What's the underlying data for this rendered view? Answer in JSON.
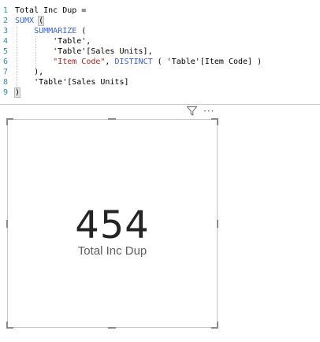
{
  "editor": {
    "lines": [
      {
        "number": "1",
        "tokens": [
          {
            "t": "plain",
            "v": "Total Inc Dup ="
          }
        ]
      },
      {
        "number": "2",
        "tokens": [
          {
            "t": "fn",
            "v": "SUMX"
          },
          {
            "t": "plain",
            "v": " "
          },
          {
            "t": "paren",
            "v": "("
          }
        ]
      },
      {
        "number": "3",
        "tokens": [
          {
            "t": "plain",
            "v": "    "
          },
          {
            "t": "fn",
            "v": "SUMMARIZE"
          },
          {
            "t": "plain",
            "v": " ("
          }
        ]
      },
      {
        "number": "4",
        "tokens": [
          {
            "t": "plain",
            "v": "        'Table',"
          }
        ]
      },
      {
        "number": "5",
        "tokens": [
          {
            "t": "plain",
            "v": "        'Table'[Sales Units],"
          }
        ]
      },
      {
        "number": "6",
        "tokens": [
          {
            "t": "plain",
            "v": "        "
          },
          {
            "t": "str",
            "v": "\"Item Code\""
          },
          {
            "t": "plain",
            "v": ", "
          },
          {
            "t": "fn",
            "v": "DISTINCT"
          },
          {
            "t": "plain",
            "v": " ( 'Table'[Item Code] )"
          }
        ]
      },
      {
        "number": "7",
        "tokens": [
          {
            "t": "plain",
            "v": "    ),"
          }
        ]
      },
      {
        "number": "8",
        "tokens": [
          {
            "t": "plain",
            "v": "    'Table'[Sales Units]"
          }
        ]
      },
      {
        "number": "9",
        "tokens": [
          {
            "t": "paren",
            "v": ")"
          }
        ]
      }
    ]
  },
  "card": {
    "value": "454",
    "caption": "Total Inc Dup"
  },
  "toolbar": {
    "filter_icon": "filter-icon",
    "more_label": "···"
  },
  "colors": {
    "keyword": "#3a62d4",
    "string": "#b0231a",
    "line_number": "#2b91af",
    "value_text": "#252423"
  }
}
